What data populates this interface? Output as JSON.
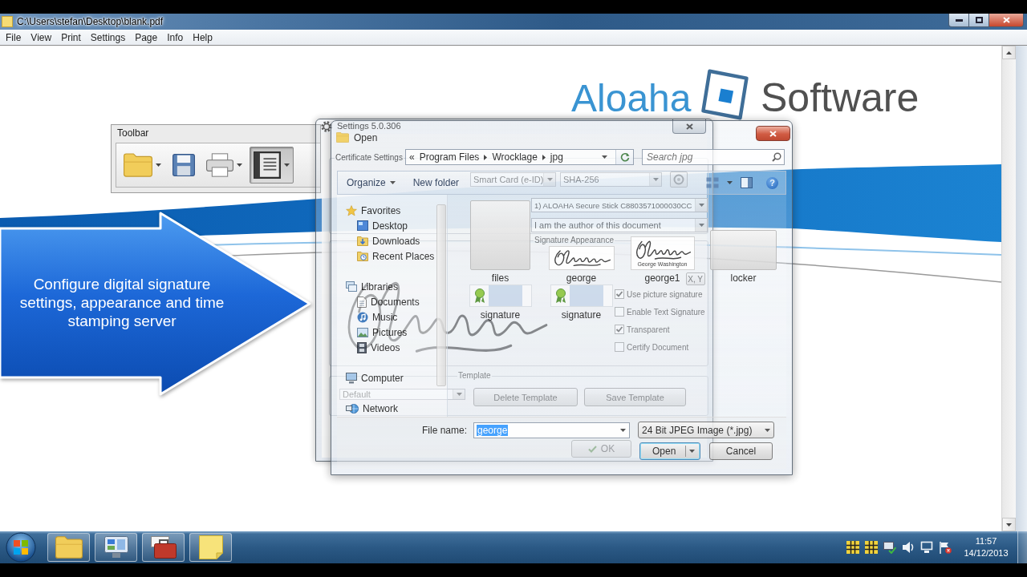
{
  "window": {
    "title": "C:\\Users\\stefan\\Desktop\\blank.pdf"
  },
  "menu": [
    "File",
    "View",
    "Print",
    "Settings",
    "Page",
    "Info",
    "Help"
  ],
  "document": {
    "logo": {
      "name": "Aloaha",
      "tagline": "Software"
    },
    "callout": "Configure digital signature settings, appearance and time stamping server"
  },
  "toolbar_panel": {
    "title": "Toolbar",
    "buttons": [
      {
        "kind": "folder",
        "dropdown": true,
        "pressed": false
      },
      {
        "kind": "save",
        "dropdown": false,
        "pressed": false
      },
      {
        "kind": "printer",
        "dropdown": true,
        "pressed": false
      },
      {
        "kind": "document",
        "dropdown": true,
        "pressed": true
      }
    ]
  },
  "settings_dialog": {
    "title": "Settings 5.0.306",
    "certificate_settings": {
      "label": "Certificate Settings",
      "device": "Smart Card (e-ID)",
      "hash": "SHA-256",
      "certificate": "1) ALOAHA Secure Stick C8803571000030CC",
      "reason": "I am the author of this document"
    },
    "signature_appearance": {
      "label": "Signature Appearance",
      "position_button": "X, Y",
      "options": [
        {
          "label": "Use picture signature",
          "checked": true
        },
        {
          "label": "Enable Text Signature",
          "checked": false
        },
        {
          "label": "Transparent",
          "checked": true
        },
        {
          "label": "Certify Document",
          "checked": false
        }
      ]
    },
    "template": {
      "label": "Template",
      "value": "Default",
      "buttons": [
        "Delete Template",
        "Save Template"
      ]
    },
    "ok_button": "OK"
  },
  "open_dialog": {
    "title": "Open",
    "breadcrumb": {
      "overflow": "«",
      "segments": [
        "Program Files",
        "Wrocklage",
        "jpg"
      ]
    },
    "search": {
      "placeholder": "Search jpg"
    },
    "command_bar": {
      "organize": "Organize",
      "new_folder": "New folder",
      "help": "?"
    },
    "navigation": [
      {
        "label": "Favorites",
        "kind": "star",
        "children": [
          {
            "label": "Desktop",
            "kind": "desktop"
          },
          {
            "label": "Downloads",
            "kind": "downloads"
          },
          {
            "label": "Recent Places",
            "kind": "recent"
          }
        ]
      },
      {
        "label": "Libraries",
        "kind": "library",
        "children": [
          {
            "label": "Documents",
            "kind": "documents"
          },
          {
            "label": "Music",
            "kind": "music"
          },
          {
            "label": "Pictures",
            "kind": "pictures"
          },
          {
            "label": "Videos",
            "kind": "videos"
          }
        ]
      },
      {
        "label": "Computer",
        "kind": "computer"
      },
      {
        "label": "Network",
        "kind": "network"
      }
    ],
    "files": [
      {
        "name": "files",
        "kind": "folder"
      },
      {
        "name": "george",
        "kind": "image"
      },
      {
        "name": "george1",
        "kind": "image",
        "caption": "George Washington"
      },
      {
        "name": "locker",
        "kind": "folder"
      },
      {
        "name": "signature",
        "kind": "certificate"
      },
      {
        "name": "signature",
        "kind": "certificate"
      }
    ],
    "file_name": {
      "label": "File name:",
      "value": "george",
      "text_selected": true
    },
    "file_type": "24 Bit JPEG Image (*.jpg)",
    "buttons": {
      "open": "Open",
      "cancel": "Cancel"
    }
  },
  "taskbar": {
    "apps": [
      {
        "kind": "explorer"
      },
      {
        "kind": "panel"
      },
      {
        "kind": "toolbox"
      },
      {
        "kind": "notes"
      }
    ],
    "clock": {
      "time": "11:57",
      "date": "14/12/2013"
    }
  }
}
